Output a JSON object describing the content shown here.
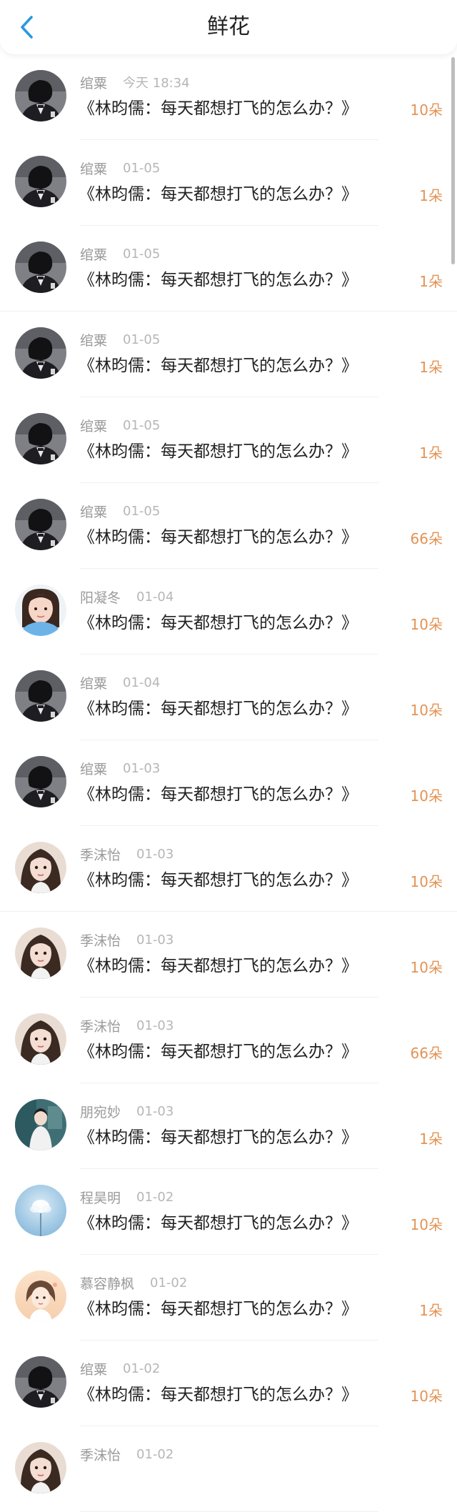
{
  "header": {
    "title": "鲜花"
  },
  "colors": {
    "accent": "#2b98e0",
    "amount": "#e39354",
    "name": "#9a9a9a",
    "time": "#b6b6b6"
  },
  "records": [
    {
      "name": "绾粟",
      "time": "今天 18:34",
      "content": "《林昀儒：每天都想打飞的怎么办？》",
      "amount": "10朵",
      "avatar": "user-dark-avatar"
    },
    {
      "name": "绾粟",
      "time": "01-05",
      "content": "《林昀儒：每天都想打飞的怎么办？》",
      "amount": "1朵",
      "avatar": "user-dark-avatar"
    },
    {
      "name": "绾粟",
      "time": "01-05",
      "content": "《林昀儒：每天都想打飞的怎么办？》",
      "amount": "1朵",
      "avatar": "user-dark-avatar"
    },
    {
      "name": "绾粟",
      "time": "01-05",
      "content": "《林昀儒：每天都想打飞的怎么办？》",
      "amount": "1朵",
      "avatar": "user-dark-avatar"
    },
    {
      "name": "绾粟",
      "time": "01-05",
      "content": "《林昀儒：每天都想打飞的怎么办？》",
      "amount": "1朵",
      "avatar": "user-dark-avatar"
    },
    {
      "name": "绾粟",
      "time": "01-05",
      "content": "《林昀儒：每天都想打飞的怎么办？》",
      "amount": "66朵",
      "avatar": "user-dark-avatar"
    },
    {
      "name": "阳凝冬",
      "time": "01-04",
      "content": "《林昀儒：每天都想打飞的怎么办？》",
      "amount": "10朵",
      "avatar": "user-blue-avatar"
    },
    {
      "name": "绾粟",
      "time": "01-04",
      "content": "《林昀儒：每天都想打飞的怎么办？》",
      "amount": "10朵",
      "avatar": "user-dark-avatar"
    },
    {
      "name": "绾粟",
      "time": "01-03",
      "content": "《林昀儒：每天都想打飞的怎么办？》",
      "amount": "10朵",
      "avatar": "user-dark-avatar"
    },
    {
      "name": "季沫怡",
      "time": "01-03",
      "content": "《林昀儒：每天都想打飞的怎么办？》",
      "amount": "10朵",
      "avatar": "user-girl-avatar"
    },
    {
      "name": "季沫怡",
      "time": "01-03",
      "content": "《林昀儒：每天都想打飞的怎么办？》",
      "amount": "10朵",
      "avatar": "user-girl-avatar"
    },
    {
      "name": "季沫怡",
      "time": "01-03",
      "content": "《林昀儒：每天都想打飞的怎么办？》",
      "amount": "66朵",
      "avatar": "user-girl-avatar"
    },
    {
      "name": "朋宛妙",
      "time": "01-03",
      "content": "《林昀儒：每天都想打飞的怎么办？》",
      "amount": "1朵",
      "avatar": "user-teal-avatar"
    },
    {
      "name": "程昊明",
      "time": "01-02",
      "content": "《林昀儒：每天都想打飞的怎么办？》",
      "amount": "10朵",
      "avatar": "user-sky-avatar"
    },
    {
      "name": "慕容静枫",
      "time": "01-02",
      "content": "《林昀儒：每天都想打飞的怎么办？》",
      "amount": "1朵",
      "avatar": "user-cartoon-avatar"
    },
    {
      "name": "绾粟",
      "time": "01-02",
      "content": "《林昀儒：每天都想打飞的怎么办？》",
      "amount": "10朵",
      "avatar": "user-dark-avatar"
    },
    {
      "name": "季沫怡",
      "time": "01-02",
      "content": "",
      "amount": "",
      "avatar": "user-girl-avatar"
    }
  ]
}
